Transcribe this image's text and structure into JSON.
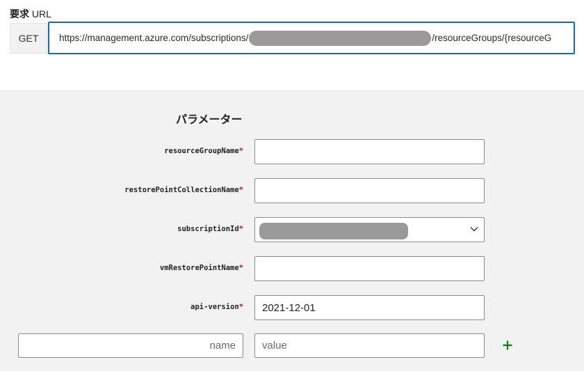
{
  "request": {
    "label_bold": "要求",
    "label_rest": " URL",
    "method": "GET",
    "url_prefix": "https://management.azure.com/subscriptions/",
    "url_suffix": "/resourceGroups/{resourceG"
  },
  "parameters": {
    "title": "パラメーター",
    "required_marker": "*",
    "fields": [
      {
        "label": "resourceGroupName",
        "value": ""
      },
      {
        "label": "restorePointCollectionName",
        "value": ""
      },
      {
        "label": "subscriptionId",
        "value": ""
      },
      {
        "label": "vmRestorePointName",
        "value": ""
      },
      {
        "label": "api-version",
        "value": "2021-12-01"
      }
    ],
    "custom": {
      "name_placeholder": "name",
      "value_placeholder": "value"
    }
  },
  "colors": {
    "accent": "#0f6cbd",
    "required": "#c50f1f",
    "add": "#107c10"
  },
  "icons": {
    "dropdown": "chevron-down-icon",
    "add": "plus-icon"
  }
}
